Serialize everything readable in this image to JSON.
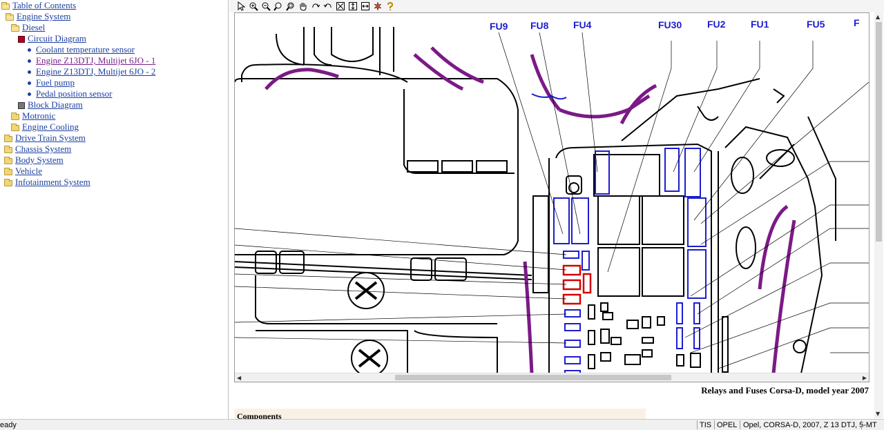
{
  "tree": {
    "toc": "Table of Contents",
    "engine_system": "Engine System",
    "diesel": "Diesel",
    "circuit_diagram": "Circuit Diagram",
    "items": [
      "Coolant temperature sensor",
      "Engine Z13DTJ, Multijet 6JO - 1",
      "Engine Z13DTJ, Multijet 6JO - 2",
      "Fuel pump",
      "Pedal position sensor"
    ],
    "block_diagram": "Block Diagram",
    "motronic": "Motronic",
    "engine_cooling": "Engine Cooling",
    "drive_train": "Drive Train System",
    "chassis": "Chassis System",
    "body": "Body System",
    "vehicle": "Vehicle",
    "infotainment": "Infotainment System"
  },
  "toolbar": {
    "icons": [
      "select-arrow-icon",
      "zoom-in-plus-icon",
      "zoom-out-minus-icon",
      "zoom-icon",
      "zoom-area-icon",
      "hand-pan-icon",
      "rotate-right-icon",
      "rotate-left-icon",
      "fit-page-icon",
      "fit-height-icon",
      "fit-width-icon",
      "highlight-icon",
      "help-icon"
    ]
  },
  "diagram": {
    "fuse_labels": [
      "FU9",
      "FU8",
      "FU4",
      "FU30",
      "FU2",
      "FU1",
      "FU5",
      "F"
    ],
    "colors": {
      "wire_purple": "#7b1a86",
      "fuse_blue": "#1c1ccf",
      "fuse_red": "#d40000",
      "line": "#000000"
    }
  },
  "caption": "Relays and Fuses Corsa-D, model year 2007",
  "components_heading": "Components",
  "status": {
    "ready": "eady",
    "tis": "TIS",
    "opel": "OPEL",
    "vehicle": "Opel, CORSA-D, 2007, Z 13 DTJ, 5-MT"
  }
}
